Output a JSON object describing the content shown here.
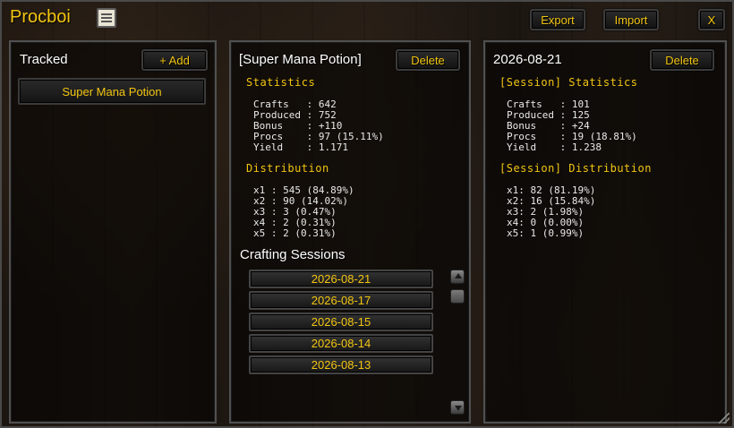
{
  "window": {
    "title": "Procboi",
    "title_icon": "scroll-icon"
  },
  "toolbar": {
    "export_label": "Export",
    "import_label": "Import",
    "close_label": "X"
  },
  "tracked_panel": {
    "heading": "Tracked",
    "add_label": "+ Add",
    "items": [
      {
        "label": "Super Mana Potion"
      }
    ]
  },
  "item_panel": {
    "heading": "[Super Mana Potion]",
    "delete_label": "Delete",
    "statistics_heading": "Statistics",
    "statistics": [
      {
        "text": "Crafts   : 642"
      },
      {
        "text": "Produced : 752"
      },
      {
        "text": "Bonus    : +110"
      },
      {
        "text": "Procs    : 97 (15.11%)"
      },
      {
        "text": "Yield    : 1.171"
      }
    ],
    "distribution_heading": "Distribution",
    "distribution": [
      {
        "text": "x1 : 545 (84.89%)"
      },
      {
        "text": "x2 : 90 (14.02%)"
      },
      {
        "text": "x3 : 3 (0.47%)"
      },
      {
        "text": "x4 : 2 (0.31%)"
      },
      {
        "text": "x5 : 2 (0.31%)"
      }
    ],
    "sessions_heading": "Crafting Sessions",
    "sessions": [
      {
        "label": "2026-08-21"
      },
      {
        "label": "2026-08-17"
      },
      {
        "label": "2026-08-15"
      },
      {
        "label": "2026-08-14"
      },
      {
        "label": "2026-08-13"
      }
    ]
  },
  "session_panel": {
    "heading": "2026-08-21",
    "delete_label": "Delete",
    "statistics_heading": "[Session] Statistics",
    "statistics": [
      {
        "text": "Crafts   : 101"
      },
      {
        "text": "Produced : 125"
      },
      {
        "text": "Bonus    : +24"
      },
      {
        "text": "Procs    : 19 (18.81%)"
      },
      {
        "text": "Yield    : 1.238"
      }
    ],
    "distribution_heading": "[Session] Distribution",
    "distribution": [
      {
        "text": "x1: 82 (81.19%)"
      },
      {
        "text": "x2: 16 (15.84%)"
      },
      {
        "text": "x3: 2 (1.98%)"
      },
      {
        "text": "x4: 0 (0.00%)"
      },
      {
        "text": "x5: 1 (0.99%)"
      }
    ]
  },
  "colors": {
    "gold": "#f2c511",
    "text": "#e9e9e9",
    "border": "#505050"
  }
}
